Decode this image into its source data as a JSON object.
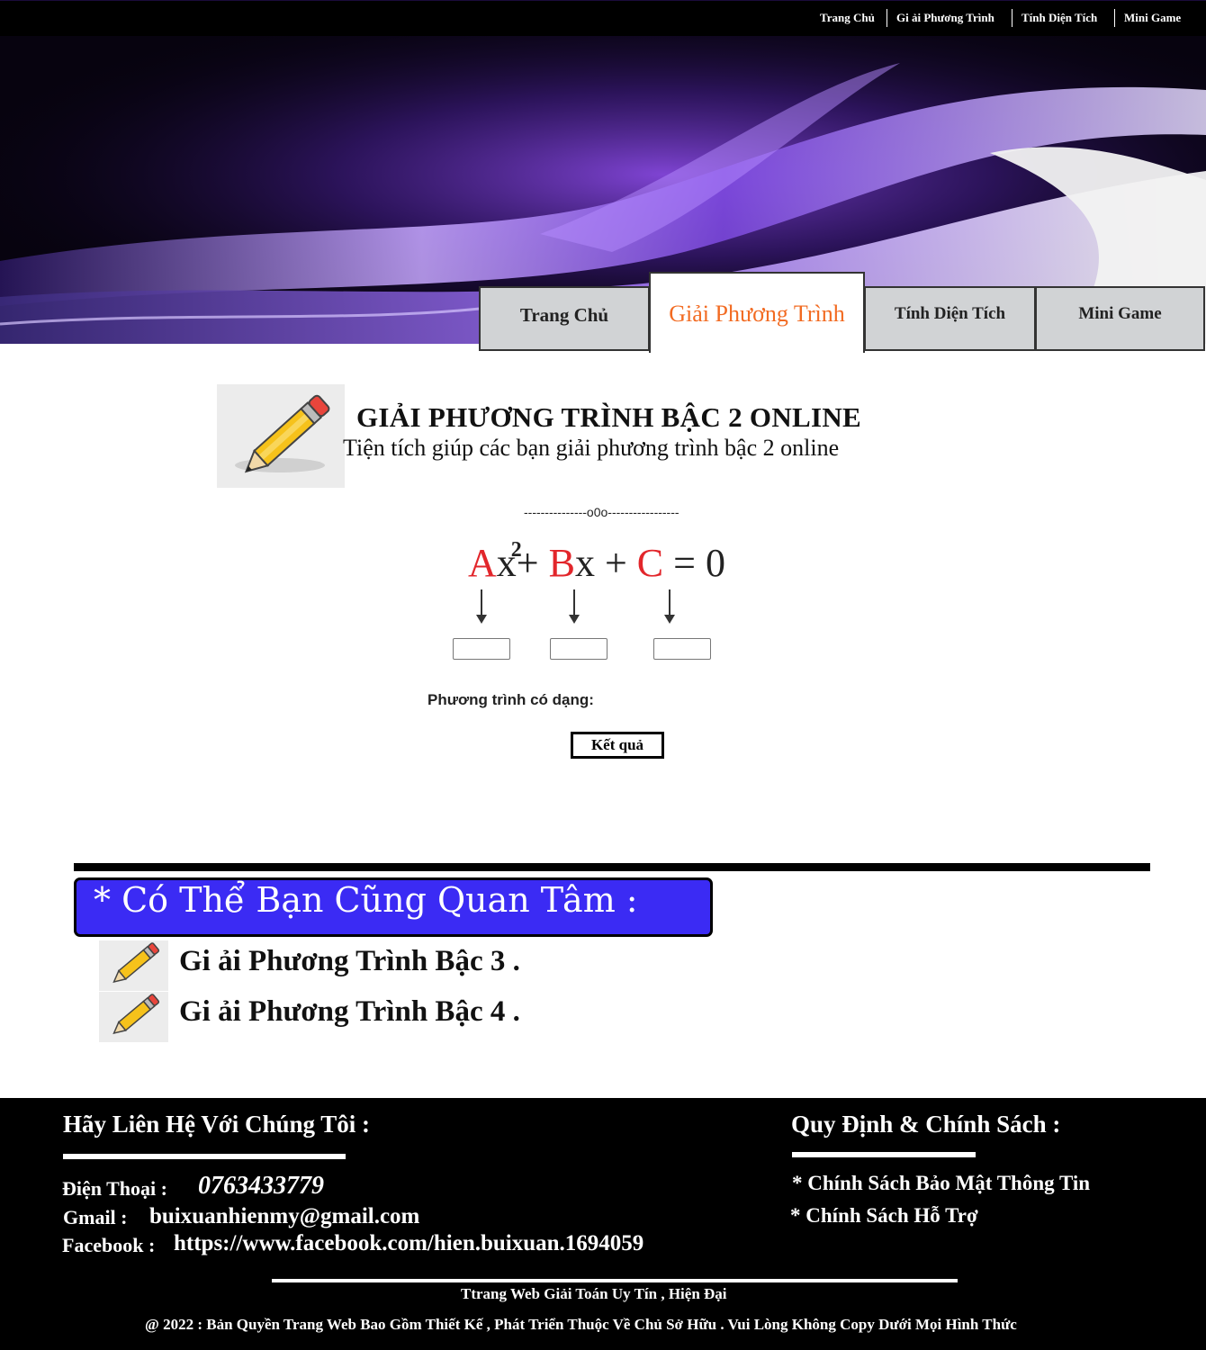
{
  "top_nav": [
    "Trang Chủ",
    "Gi ải Phương Trình",
    "Tính Diện Tích",
    "Mini Game"
  ],
  "tabs": [
    "Trang Chủ",
    "Giải Phương Trình",
    "Tính Diện Tích",
    "Mini Game"
  ],
  "active_tab": "Giải Phương Trình",
  "hero": {
    "icon": "pencil-icon",
    "title": "GIẢI PHƯƠNG TRÌNH BẬC 2 ONLINE",
    "subtitle": "Tiện tích giúp các bạn giải phương trình bậc 2 online"
  },
  "divider": "---------------o0o-----------------",
  "equation": {
    "a": "A",
    "x": "x",
    "sq": "2",
    "plus1": "+",
    "b": "B",
    "x2": "x",
    "plus2": "+",
    "c": "C",
    "equals": "= 0"
  },
  "inputs": {
    "a_value": "",
    "b_value": "",
    "c_value": ""
  },
  "equation_form_label": "Phương trình có dạng:",
  "result_button": "Kết quả",
  "related": {
    "heading": "* Có Thể Bạn Cũng Quan Tâm :",
    "items": [
      "Gi ải Phương Trình Bậc 3 .",
      "Gi ải Phương Trình Bậc 4 ."
    ]
  },
  "footer": {
    "contact_heading": "Hãy Liên Hệ Với Chúng Tôi :",
    "phone_label": "Điện Thoại :",
    "phone": "0763433779",
    "gmail_label": "Gmail :",
    "gmail": "buixuanhienmy@gmail.com",
    "facebook_label": "Facebook :",
    "facebook": "https://www.facebook.com/hien.buixuan.1694059",
    "policy_heading": "Quy Định & Chính Sách :",
    "policies": [
      "* Chính Sách Bảo Mật Thông Tin",
      "* Chính Sách Hỗ Trợ"
    ],
    "tagline": "Ttrang Web Giải Toán Uy Tín , Hiện Đại",
    "copyright": "@ 2022 : Bản Quyền Trang Web Bao Gồm Thiết Kế , Phát Triển Thuộc Về Chủ Sở Hữu . Vui Lòng Không Copy Dưới Mọi Hình Thức"
  },
  "colors": {
    "accent_orange": "#f26b22",
    "equation_red": "#e2262b",
    "related_blue": "#3b2bf4",
    "banner_purple": "#7a3bd6"
  }
}
